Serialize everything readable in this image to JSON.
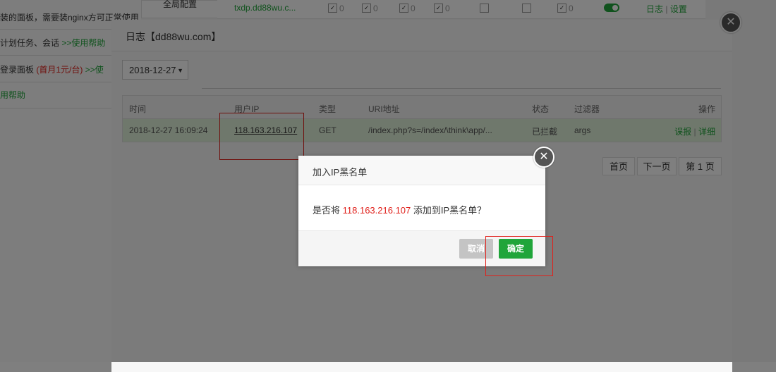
{
  "background": {
    "sidebar_lines": [
      {
        "text": "装的面板，需要装nginx方可正常使用"
      },
      {
        "text_main": "计划任务、会话",
        "text_link": ">>使用帮助"
      },
      {
        "text_main": "登录面板",
        "text_red": "(首月1元/台)",
        "text_link": ">>使"
      },
      {
        "text_link": "用帮助"
      }
    ],
    "tab_label": "全局配置",
    "row": {
      "domain": "txdp.dd88wu.c...",
      "counts": [
        "0",
        "0",
        "0",
        "0"
      ],
      "count_last": "0",
      "link_log": "日志",
      "link_sep": "|",
      "link_settings": "设置"
    }
  },
  "log_window": {
    "title": "日志【dd88wu.com】",
    "close_glyph": "✕",
    "date_select": {
      "value": "2018-12-27",
      "arrow": "▼"
    },
    "table": {
      "headers": {
        "time": "时间",
        "ip": "用户IP",
        "type": "类型",
        "uri": "URI地址",
        "status": "状态",
        "filter": "过滤器",
        "ops": "操作"
      },
      "row": {
        "time": "2018-12-27 16:09:24",
        "ip": "118.163.216.107",
        "type": "GET",
        "uri": "/index.php?s=/index/\\think\\app/...",
        "status": "已拦截",
        "filter": "args",
        "op_report": "误报",
        "op_sep": "|",
        "op_detail": "详细"
      }
    },
    "pager": {
      "first": "首页",
      "next": "下一页",
      "current": "第 1 页"
    }
  },
  "dialog": {
    "title": "加入IP黑名单",
    "close_glyph": "✕",
    "message_prefix": "是否将 ",
    "message_ip": "118.163.216.107",
    "message_suffix": " 添加到IP黑名单？",
    "cancel_label": "取消",
    "confirm_label": "确定"
  },
  "colors": {
    "accent": "#20a53a",
    "highlight_red": "#e0201b",
    "row_green": "#dff0d8"
  }
}
